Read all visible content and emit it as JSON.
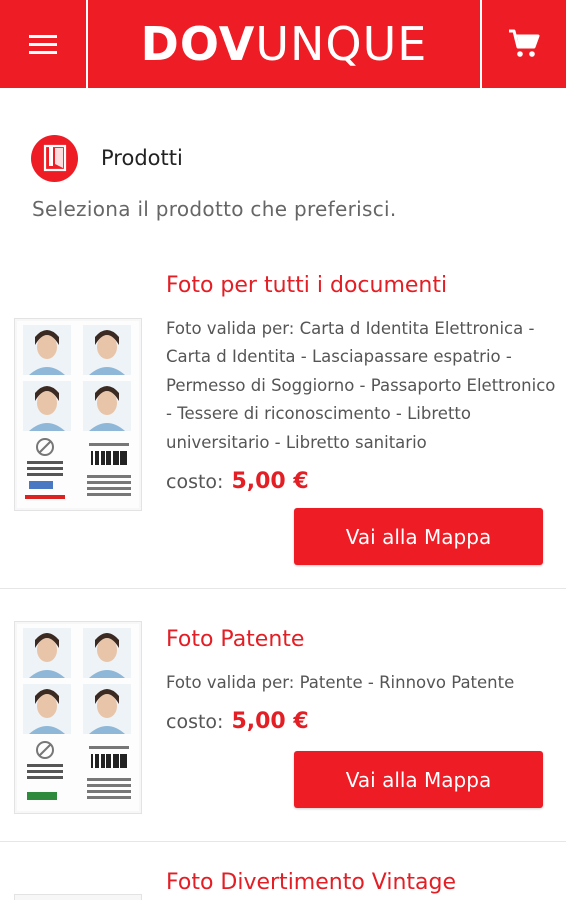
{
  "header": {
    "logo_bold": "DOV",
    "logo_light": "UNQUE",
    "menu_icon": "hamburger-menu-icon",
    "cart_icon": "shopping-cart-icon",
    "brand_color": "#ee1c25"
  },
  "section": {
    "icon": "photo-booth-icon",
    "title": "Prodotti",
    "subtitle": "Seleziona il prodotto che preferisci."
  },
  "products": [
    {
      "title": "Foto per tutti i documenti",
      "description": "Foto valida per: Carta d Identita Elettronica - Carta d Identita - Lasciapassare espatrio - Permesso di Soggiorno - Passaporto Elettronico - Tessere di riconoscimento - Libretto universitario - Libretto sanitario",
      "cost_label": "costo:",
      "price": "5,00 €",
      "button_label": "Vai alla Mappa"
    },
    {
      "title": "Foto Patente",
      "description": "Foto valida per: Patente - Rinnovo Patente",
      "cost_label": "costo:",
      "price": "5,00 €",
      "button_label": "Vai alla Mappa"
    },
    {
      "title": "Foto Divertimento Vintage"
    }
  ]
}
